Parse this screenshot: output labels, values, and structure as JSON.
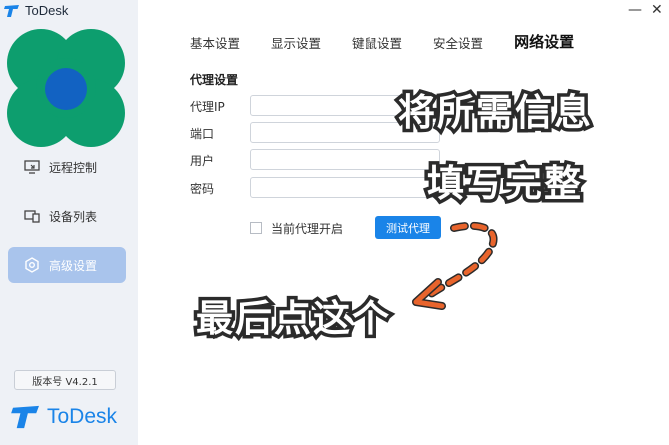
{
  "app": {
    "title": "ToDesk",
    "brand_name": "ToDesk",
    "brand_color": "#1a84e8"
  },
  "window": {
    "minimize_icon": "minimize-icon",
    "close_icon": "close-icon"
  },
  "sidebar": {
    "items": [
      {
        "label": "远程控制",
        "icon": "remote-control-icon",
        "active": false
      },
      {
        "label": "设备列表",
        "icon": "device-list-icon",
        "active": false
      },
      {
        "label": "高级设置",
        "icon": "settings-gear-icon",
        "active": true
      }
    ],
    "version": "版本号 V4.2.1"
  },
  "tabs": [
    {
      "label": "基本设置",
      "active": false
    },
    {
      "label": "显示设置",
      "active": false
    },
    {
      "label": "键鼠设置",
      "active": false
    },
    {
      "label": "安全设置",
      "active": false
    },
    {
      "label": "网络设置",
      "active": true
    }
  ],
  "proxy": {
    "section_title": "代理设置",
    "fields": [
      {
        "label": "代理IP",
        "value": ""
      },
      {
        "label": "端口",
        "value": ""
      },
      {
        "label": "用户",
        "value": ""
      },
      {
        "label": "密码",
        "value": ""
      }
    ],
    "enable_checkbox_label": "当前代理开启",
    "enable_checked": false,
    "test_button": "测试代理"
  },
  "annotations": {
    "line1": "将所需信息",
    "line2": "填写完整",
    "line3": "最后点这个",
    "arrow_color": "#e8642c"
  }
}
